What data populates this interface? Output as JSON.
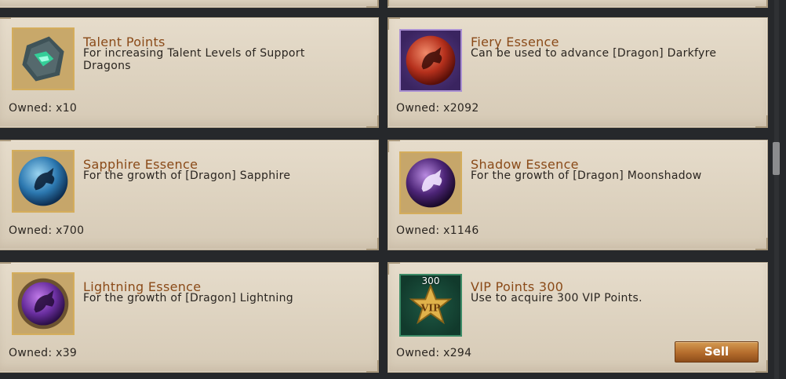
{
  "owned_prefix": "Owned: ",
  "items": [
    {
      "title": "Talent Points",
      "desc": "For increasing Talent Levels of Support Dragons",
      "owned": "Owned: x10",
      "icon": "talent-stone-icon"
    },
    {
      "title": "Fiery Essence",
      "desc": "Can be used to advance [Dragon] Darkfyre",
      "owned": "Owned: x2092",
      "icon": "fiery-dragon-orb-icon"
    },
    {
      "title": "Sapphire Essence",
      "desc": "For the growth of [Dragon] Sapphire",
      "owned": "Owned: x700",
      "icon": "sapphire-dragon-orb-icon"
    },
    {
      "title": "Shadow Essence",
      "desc": "For the growth of [Dragon] Moonshadow",
      "owned": "Owned: x1146",
      "icon": "shadow-dragon-orb-icon"
    },
    {
      "title": "Lightning Essence",
      "desc": "For the growth of [Dragon] Lightning",
      "owned": "Owned: x39",
      "icon": "lightning-dragon-orb-icon"
    },
    {
      "title": "VIP Points 300",
      "desc": "Use to acquire 300 VIP Points.",
      "owned": "Owned: x294",
      "icon": "vip-star-icon",
      "badge": "300"
    }
  ],
  "sell_label": "Sell",
  "colors": {
    "title": "#8a4a18",
    "card": "#e1d6c4",
    "background": "#26282b",
    "sell": "#b46c2c"
  }
}
